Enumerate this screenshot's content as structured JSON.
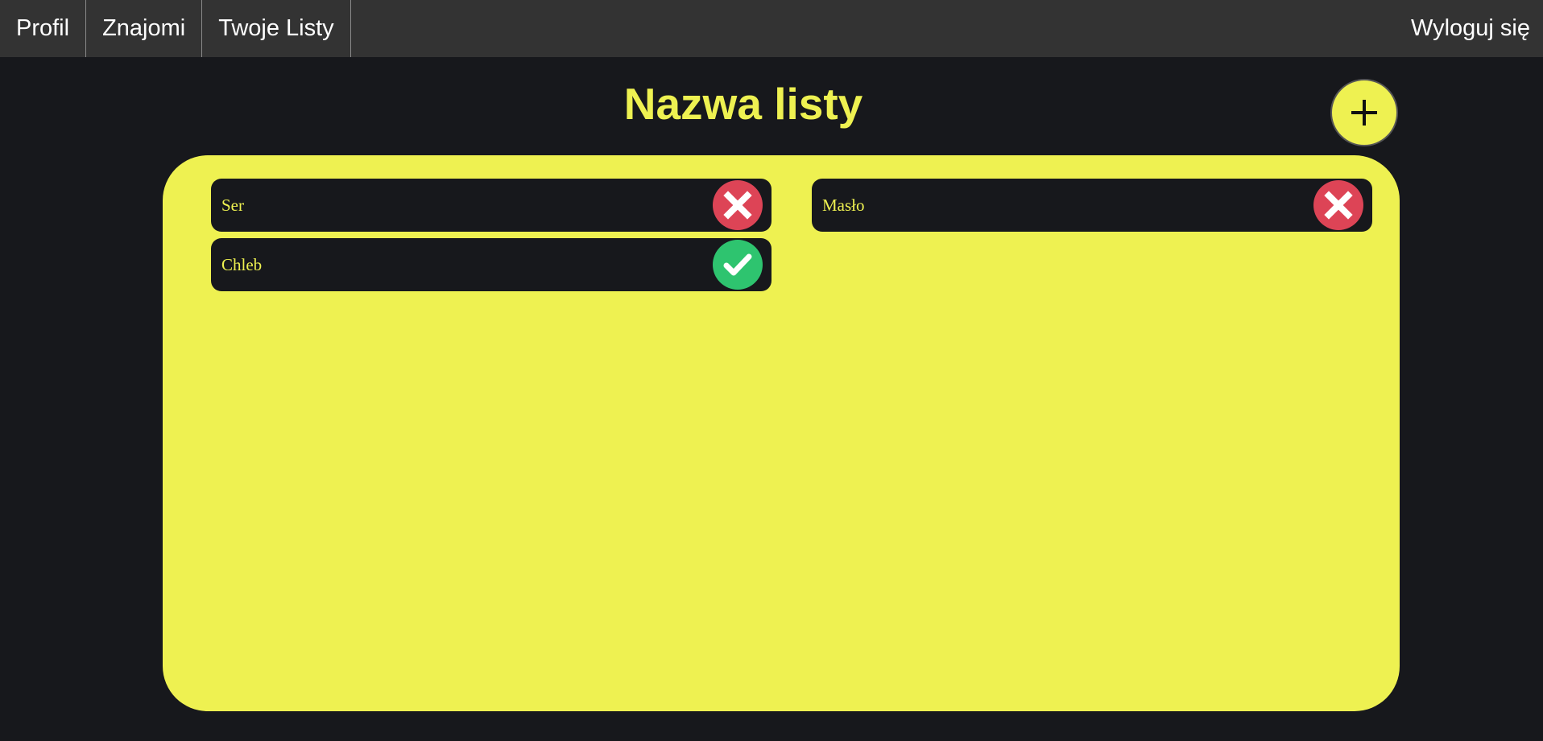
{
  "nav": {
    "items": [
      {
        "label": "Profil"
      },
      {
        "label": "Znajomi"
      },
      {
        "label": "Twoje Listy"
      }
    ],
    "logout_label": "Wyloguj się"
  },
  "page": {
    "title": "Nazwa listy",
    "add_button_icon": "plus-icon"
  },
  "list": {
    "items": [
      {
        "label": "Ser",
        "status": "not-bought",
        "icon": "x-icon"
      },
      {
        "label": "Chleb",
        "status": "bought",
        "icon": "check-icon"
      },
      {
        "label": "Masło",
        "status": "not-bought",
        "icon": "x-icon"
      }
    ]
  },
  "colors": {
    "accent_yellow": "#eef151",
    "background": "#17181c",
    "navbar": "#333333",
    "remove_red": "#dd4456",
    "done_green": "#2ec46f"
  }
}
